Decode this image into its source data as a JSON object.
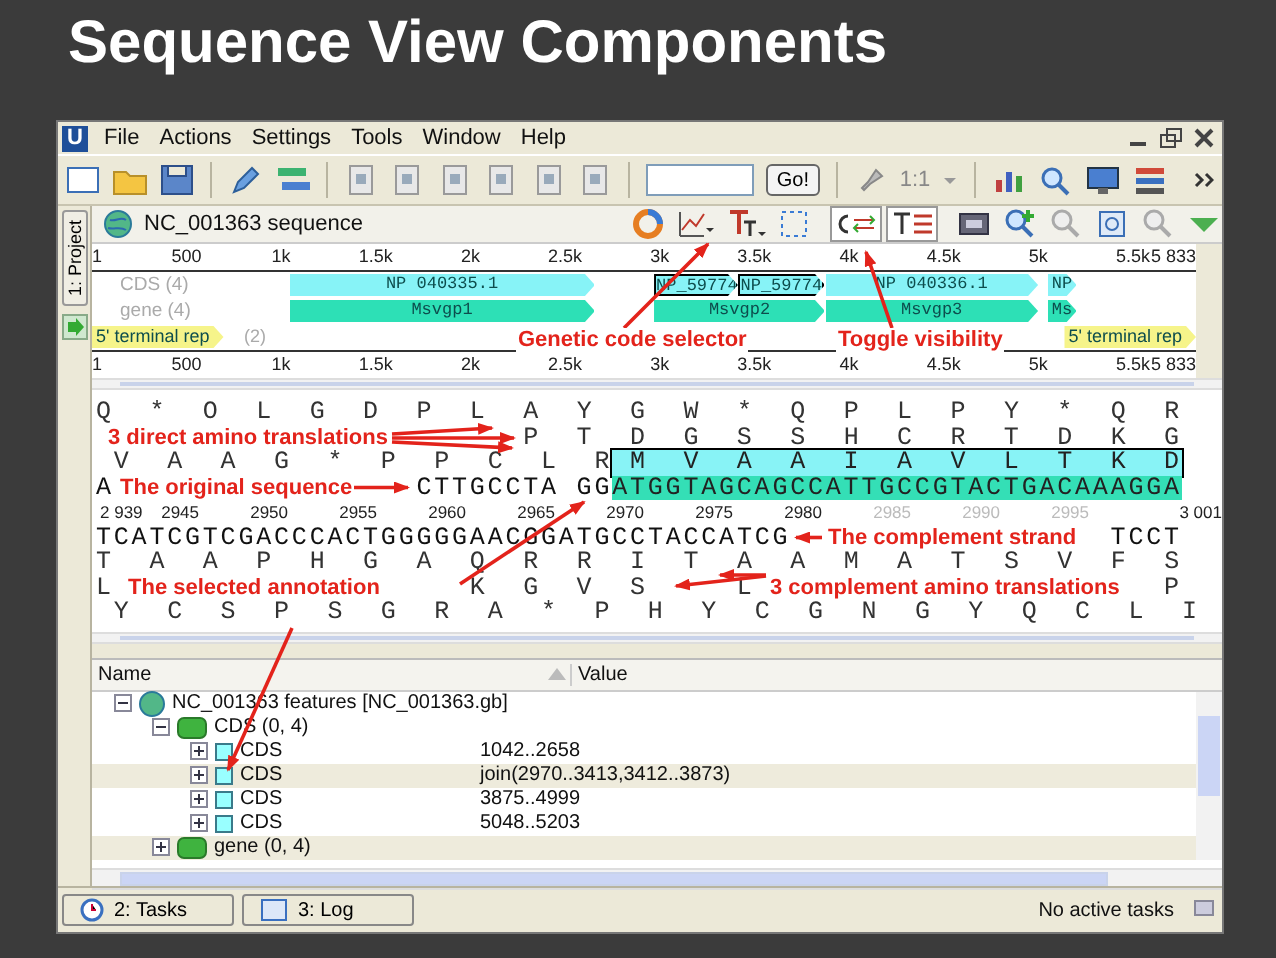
{
  "slide_title": "Sequence View Components",
  "app_logo": "U",
  "menu": [
    "File",
    "Actions",
    "Settings",
    "Tools",
    "Window",
    "Help"
  ],
  "toolbar": {
    "go_button": "Go!",
    "zoom": "1:1"
  },
  "left_panel_tab": "1: Project",
  "sequence_title": "NC_001363 sequence",
  "overview": {
    "ruler": [
      "1",
      "500",
      "1k",
      "1.5k",
      "2k",
      "2.5k",
      "3k",
      "3.5k",
      "4k",
      "4.5k",
      "5k",
      "5.5k",
      "5 833"
    ],
    "tracks": [
      {
        "kind": "cds",
        "name": "CDS (4)",
        "items": [
          {
            "label": "NP 040335.1",
            "selected": false
          },
          {
            "label": "NP_59774",
            "selected": true
          },
          {
            "label": "NP_59774",
            "selected": true
          },
          {
            "label": "NP 040336.1",
            "selected": false
          },
          {
            "label": "NP",
            "selected": false
          }
        ]
      },
      {
        "kind": "gene",
        "name": "gene (4)",
        "items": [
          {
            "label": "Msvgp1",
            "selected": false
          },
          {
            "label": "Msvgp2",
            "selected": false
          },
          {
            "label": "Msvgp3",
            "selected": false
          },
          {
            "label": "Ms",
            "selected": false
          }
        ]
      },
      {
        "kind": "repeat",
        "name": "(2)",
        "items": [
          {
            "label": "5' terminal rep",
            "selected": false
          },
          {
            "label": "5' terminal rep",
            "selected": false
          }
        ]
      }
    ],
    "ruler_2": [
      "1",
      "500",
      "1k",
      "1.5k",
      "2k",
      "2.5k",
      "3k",
      "3.5k",
      "4k",
      "4.5k",
      "5k",
      "5.5k",
      "5 833"
    ]
  },
  "sequence_rows": [
    {
      "kind": "amino",
      "text": "Q  *  O  L  G  D  P  L  A  Y  G  W  *  Q  P  L  P  Y  *  Q  R"
    },
    {
      "kind": "amino",
      "text": "                        P  T  D  G  S  S  H  C  R  T  D  K  G"
    },
    {
      "kind": "amino",
      "text": " V  A  A  G  *  P  P  C  L  R",
      "annotated": " M  V  A  A  I  A  V  L  T  K  D"
    },
    {
      "kind": "dna",
      "text": "A                 CTTGCCTA GG",
      "annotated": "ATGGTAGCAGCCATTGCCGTACTGACAAAGGA"
    },
    {
      "kind": "ruler",
      "labels": [
        "2 939",
        "2945",
        "2950",
        "2955",
        "2960",
        "2965",
        "2970",
        "2975",
        "2980",
        "2985",
        "2990",
        "2995",
        "3 001"
      ]
    },
    {
      "kind": "dna",
      "text": "TCATCGTCGACCCACTGGGGGAACGGATGCCTACCATCG                  TCCT"
    },
    {
      "kind": "amino",
      "text": "T  A  A  P  H  G  A  Q  R  R  I  T  A  A  M  A  T  S  V  F  S"
    },
    {
      "kind": "amino",
      "text": "L                    K  G  V  S     L                       P"
    },
    {
      "kind": "amino",
      "text": " Y  C  S  P  S  G  R  A  *  P  H  Y  C  G  N  G  Y  Q  C  L  I"
    }
  ],
  "callouts": [
    "Genetic code selector",
    "Toggle visibility",
    "3 direct amino translations",
    "The original sequence",
    "The complement strand",
    "The selected annotation",
    "3 complement amino translations"
  ],
  "features_table": {
    "columns": [
      "Name",
      "Value"
    ],
    "tree": [
      {
        "kind": "sequence",
        "label": "NC_001363 features [NC_001363.gb]",
        "expanded": true,
        "selected": false,
        "children": [
          {
            "kind": "group",
            "label": "CDS  (0, 4)",
            "expanded": true,
            "selected": false,
            "children": [
              {
                "kind": "feature",
                "label": "CDS",
                "value": "1042..2658",
                "expanded": false,
                "selected": false
              },
              {
                "kind": "feature",
                "label": "CDS",
                "value": "join(2970..3413,3412..3873)",
                "expanded": false,
                "selected": true
              },
              {
                "kind": "feature",
                "label": "CDS",
                "value": "3875..4999",
                "expanded": false,
                "selected": false
              },
              {
                "kind": "feature",
                "label": "CDS",
                "value": "5048..5203",
                "expanded": false,
                "selected": false
              }
            ]
          },
          {
            "kind": "group",
            "label": "gene  (0, 4)",
            "expanded": false,
            "selected": true
          }
        ]
      }
    ]
  },
  "bottom_tabs": [
    "2: Tasks",
    "3: Log"
  ],
  "status": "No active tasks"
}
